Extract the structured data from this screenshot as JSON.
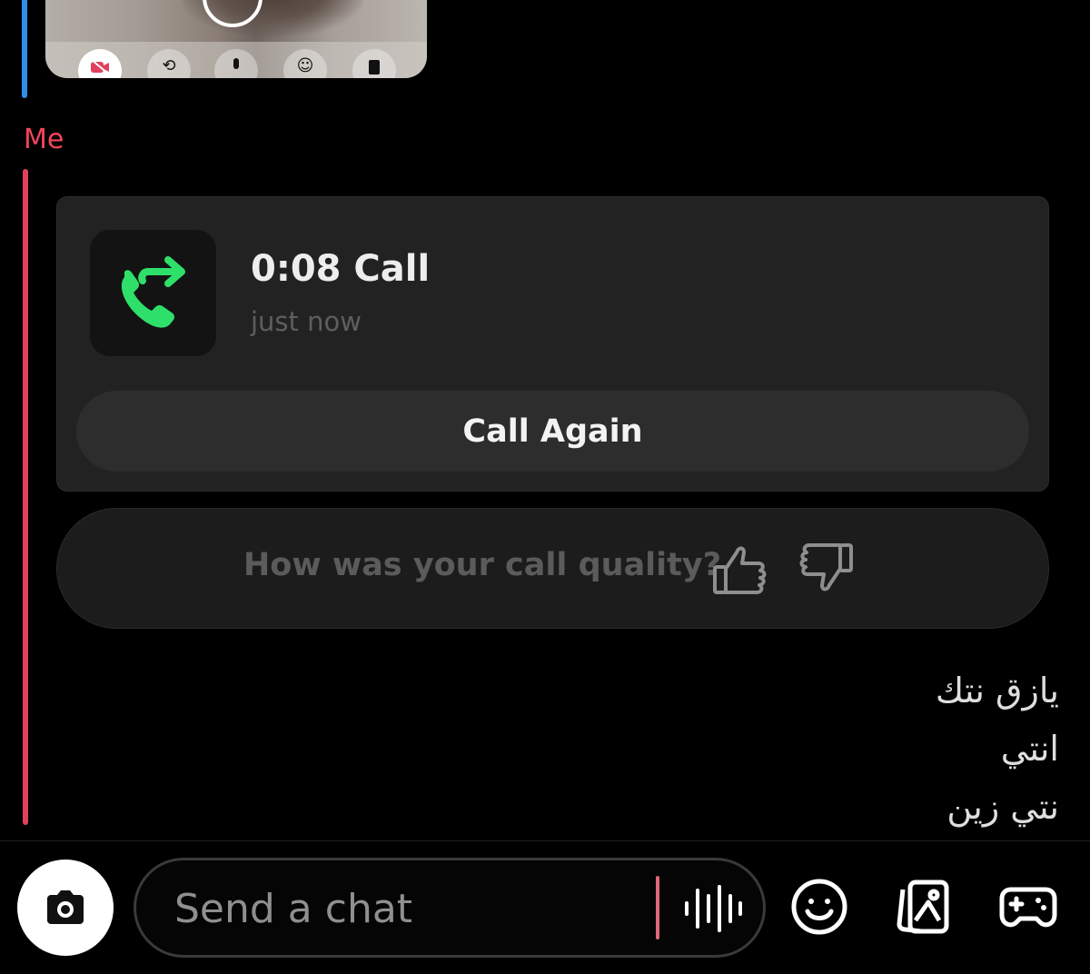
{
  "video_preview": {
    "controls": [
      "camera-off-icon",
      "flip-icon",
      "mic-icon",
      "lens-icon",
      "more-icon"
    ],
    "accent": "#2f8ee5"
  },
  "sender_label": "Me",
  "colors": {
    "me": "#f0455a",
    "call_green": "#2ee06a"
  },
  "call_card": {
    "icon": "outgoing-call-icon",
    "title": "0:08 Call",
    "time": "just now",
    "call_again_label": "Call Again"
  },
  "call_quality": {
    "question": "How was your call quality?",
    "thumbs_up": "thumbs-up-icon",
    "thumbs_down": "thumbs-down-icon"
  },
  "message_lines": [
    "يازق نتك",
    "انتي",
    "نتي زين"
  ],
  "composer": {
    "placeholder": "Send a chat",
    "icons": [
      "camera-icon",
      "voice-icon",
      "emoji-icon",
      "stickers-icon",
      "games-icon"
    ]
  }
}
